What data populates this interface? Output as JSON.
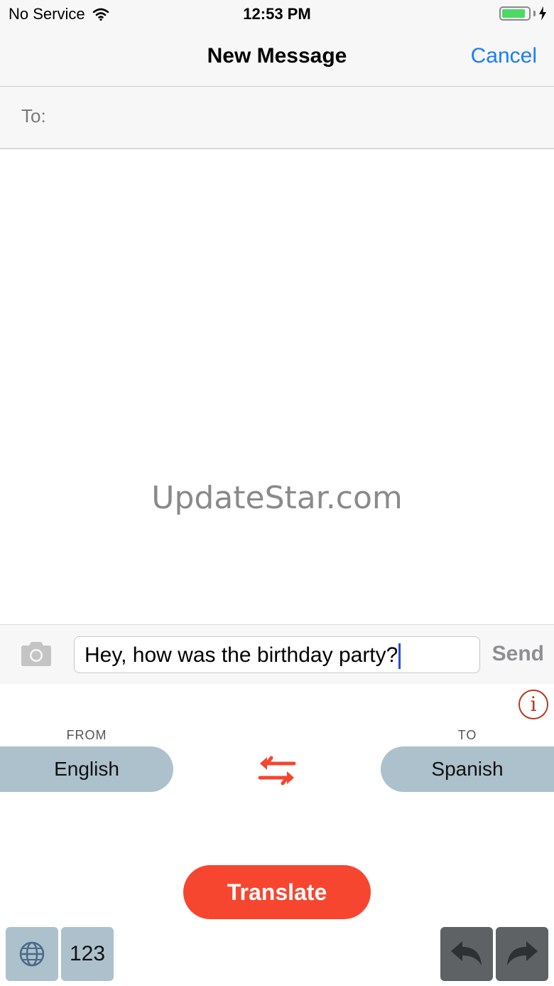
{
  "status_bar": {
    "carrier": "No Service",
    "time": "12:53 PM",
    "battery_level": 0.9,
    "icons": [
      "wifi-icon",
      "battery-icon",
      "charging-bolt-icon"
    ]
  },
  "nav": {
    "title": "New Message",
    "cancel_label": "Cancel"
  },
  "to_field": {
    "label": "To:"
  },
  "watermark": "UpdateStar.com",
  "composer": {
    "message_text": "Hey, how was the birthday party?",
    "send_label": "Send",
    "camera_icon": "camera-icon"
  },
  "translator": {
    "info_icon": "info-icon",
    "from_label": "FROM",
    "to_label": "TO",
    "from_language": "English",
    "to_language": "Spanish",
    "swap_icon": "swap-arrows-icon",
    "translate_label": "Translate"
  },
  "keyboard": {
    "globe_icon": "globe-icon",
    "numbers_label": "123",
    "undo_icon": "undo-icon",
    "redo_icon": "redo-icon"
  },
  "colors": {
    "accent_blue": "#1a7df7",
    "translate_red": "#f64630",
    "language_pill": "#acc1cc",
    "info_red": "#b5391e",
    "battery_green": "#4cd964",
    "dark_key": "#5f6264"
  }
}
